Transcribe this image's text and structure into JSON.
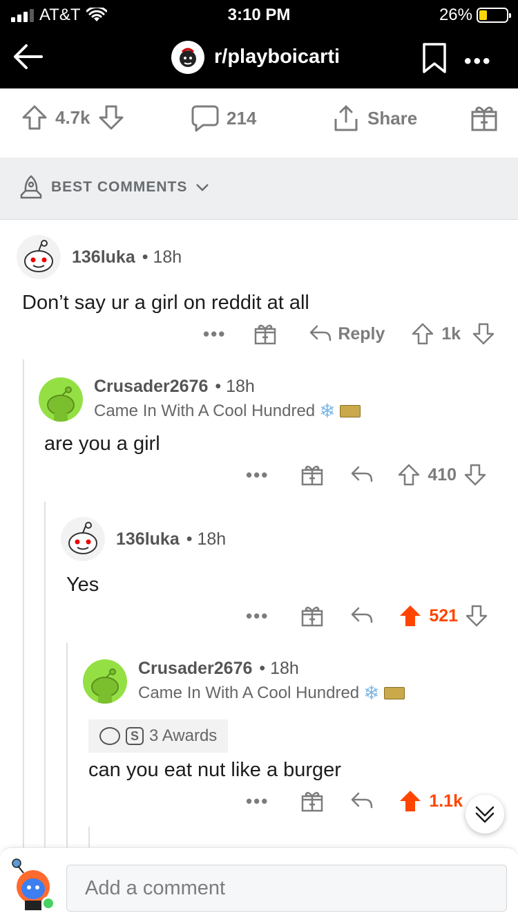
{
  "status": {
    "carrier": "AT&T",
    "time": "3:10 PM",
    "battery": "26%"
  },
  "header": {
    "subreddit": "r/playboicarti"
  },
  "post_actions": {
    "upvotes": "4.7k",
    "comments": "214",
    "share": "Share"
  },
  "sort": {
    "label": "BEST COMMENTS"
  },
  "comments": [
    {
      "author": "136luka",
      "time": "18h",
      "body": "Don’t say ur a girl on reddit at all",
      "reply": "Reply",
      "score": "1k"
    },
    {
      "author": "Crusader2676",
      "time": "18h",
      "flair": "Came In With A Cool Hundred",
      "body": "are you a girl",
      "score": "410"
    },
    {
      "author": "136luka",
      "time": "18h",
      "body": "Yes",
      "score": "521"
    },
    {
      "author": "Crusader2676",
      "time": "18h",
      "flair": "Came In With A Cool Hundred",
      "awards": "3 Awards",
      "body": "can you eat nut like a burger",
      "score": "1.1k"
    }
  ],
  "composer": {
    "placeholder": "Add a comment"
  },
  "colors": {
    "upvote": "#ff4500",
    "online": "#46d160",
    "header_bg": "#000000"
  }
}
